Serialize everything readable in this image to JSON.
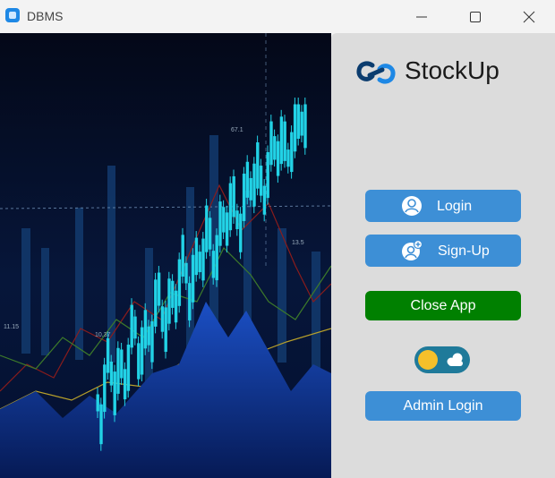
{
  "window": {
    "title": "DBMS",
    "icons": [
      "app-icon",
      "minimize-icon",
      "maximize-icon",
      "close-icon"
    ]
  },
  "hero": {
    "image": "stock-candlestick-chart-background",
    "annotations": [
      "67.1",
      "13.5",
      "10.37",
      "11.15"
    ]
  },
  "brand": {
    "name": "StockUp",
    "logo_icon": "link-infinity-logo",
    "logo_color": "#0b3c6e"
  },
  "buttons": {
    "login": {
      "label": "Login",
      "icon": "user-circle-icon"
    },
    "signup": {
      "label": "Sign-Up",
      "icon": "user-add-icon"
    },
    "close_app": {
      "label": "Close App"
    },
    "admin_login": {
      "label": "Admin Login"
    }
  },
  "theme_toggle": {
    "state": "light",
    "icons": [
      "sun-icon",
      "cloud-icon"
    ]
  },
  "colors": {
    "panel_bg": "#dcdcdc",
    "button_blue": "#3d8fd6",
    "button_green": "#008000",
    "toggle_track": "#1f7a9a",
    "toggle_knob": "#f5c02a"
  }
}
